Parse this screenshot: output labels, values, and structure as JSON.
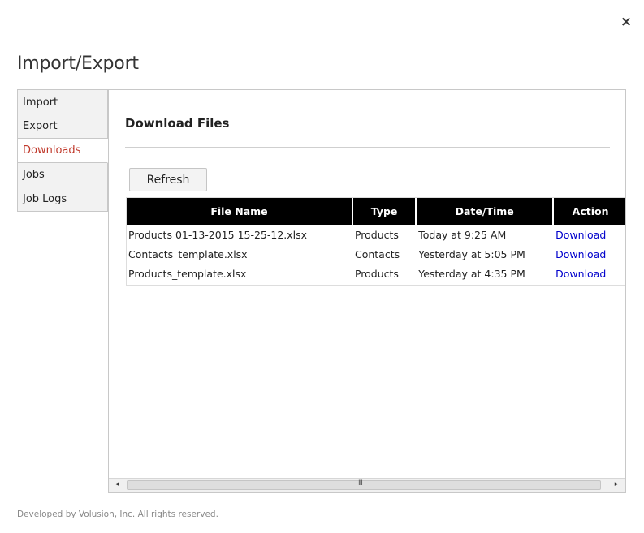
{
  "dialog": {
    "title": "Import/Export",
    "close_glyph": "×"
  },
  "sidebar": {
    "items": [
      {
        "label": "Import"
      },
      {
        "label": "Export"
      },
      {
        "label": "Downloads",
        "active": true
      },
      {
        "label": "Jobs"
      },
      {
        "label": "Job Logs"
      }
    ]
  },
  "panel": {
    "heading": "Download Files",
    "refresh_label": "Refresh"
  },
  "table": {
    "columns": [
      "File Name",
      "Type",
      "Date/Time",
      "Action"
    ],
    "rows": [
      {
        "file_name": "Products 01-13-2015 15-25-12.xlsx",
        "type": "Products",
        "datetime": "Today at 9:25 AM",
        "action": "Download"
      },
      {
        "file_name": "Contacts_template.xlsx",
        "type": "Contacts",
        "datetime": "Yesterday at 5:05 PM",
        "action": "Download"
      },
      {
        "file_name": "Products_template.xlsx",
        "type": "Products",
        "datetime": "Yesterday at 4:35 PM",
        "action": "Download"
      }
    ]
  },
  "scrollbar": {
    "left_glyph": "◂",
    "right_glyph": "▸",
    "grip_glyph": "III"
  },
  "footer": {
    "text": "Developed by Volusion, Inc. All rights reserved."
  },
  "colors": {
    "active_nav": "#c0392b",
    "link": "#0000cc",
    "header_bg": "#000000"
  }
}
